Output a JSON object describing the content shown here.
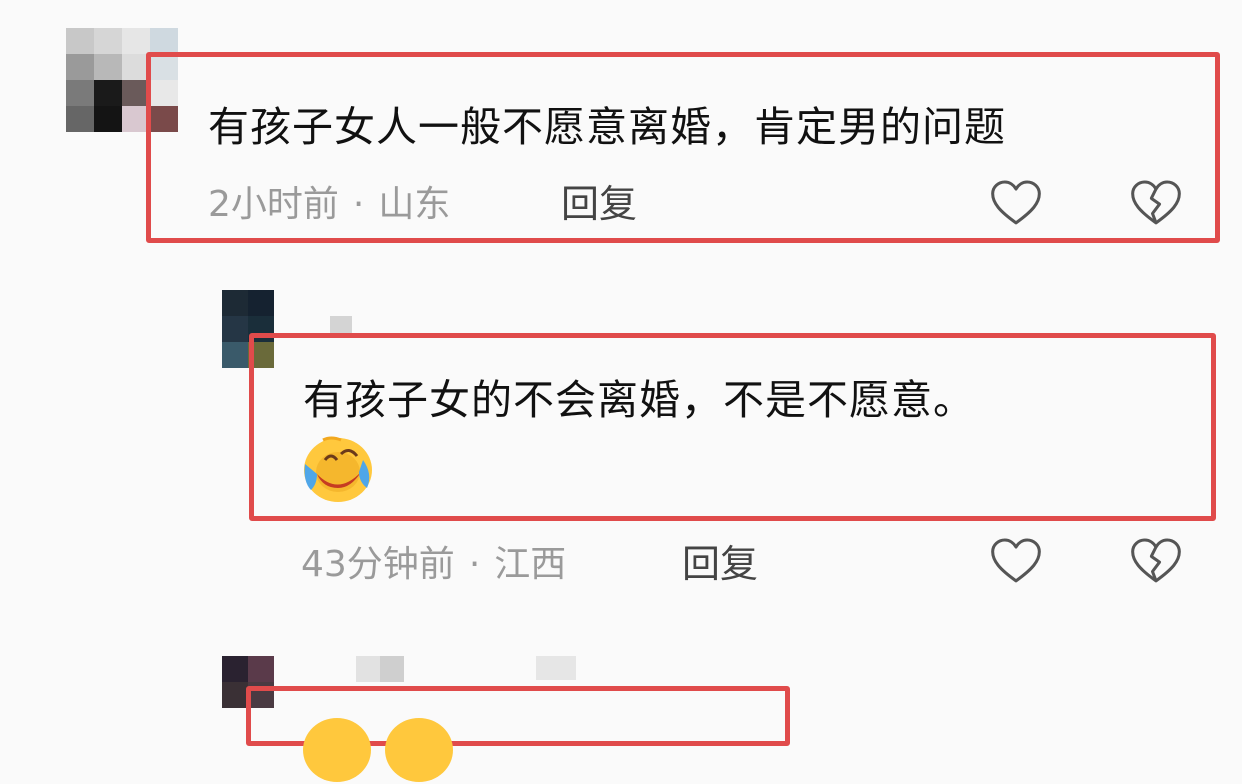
{
  "colors": {
    "highlight_border": "#e04b4b",
    "text": "#111111",
    "meta": "#9a9a9a",
    "reply": "#444444",
    "icon": "#555555"
  },
  "comments": [
    {
      "text": "有孩子女人一般不愿意离婚，肯定男的问题",
      "time": "2小时前",
      "location": "山东",
      "reply_label": "回复",
      "icons": [
        "heart-outline-icon",
        "broken-heart-icon"
      ]
    },
    {
      "text": "有孩子女的不会离婚，不是不愿意。",
      "emoji": "laughing-crying-emoji",
      "time": "43分钟前",
      "location": "江西",
      "reply_label": "回复",
      "icons": [
        "heart-outline-icon",
        "broken-heart-icon"
      ]
    },
    {
      "emoji": "laughing-crying-emoji"
    }
  ],
  "separator": "·"
}
